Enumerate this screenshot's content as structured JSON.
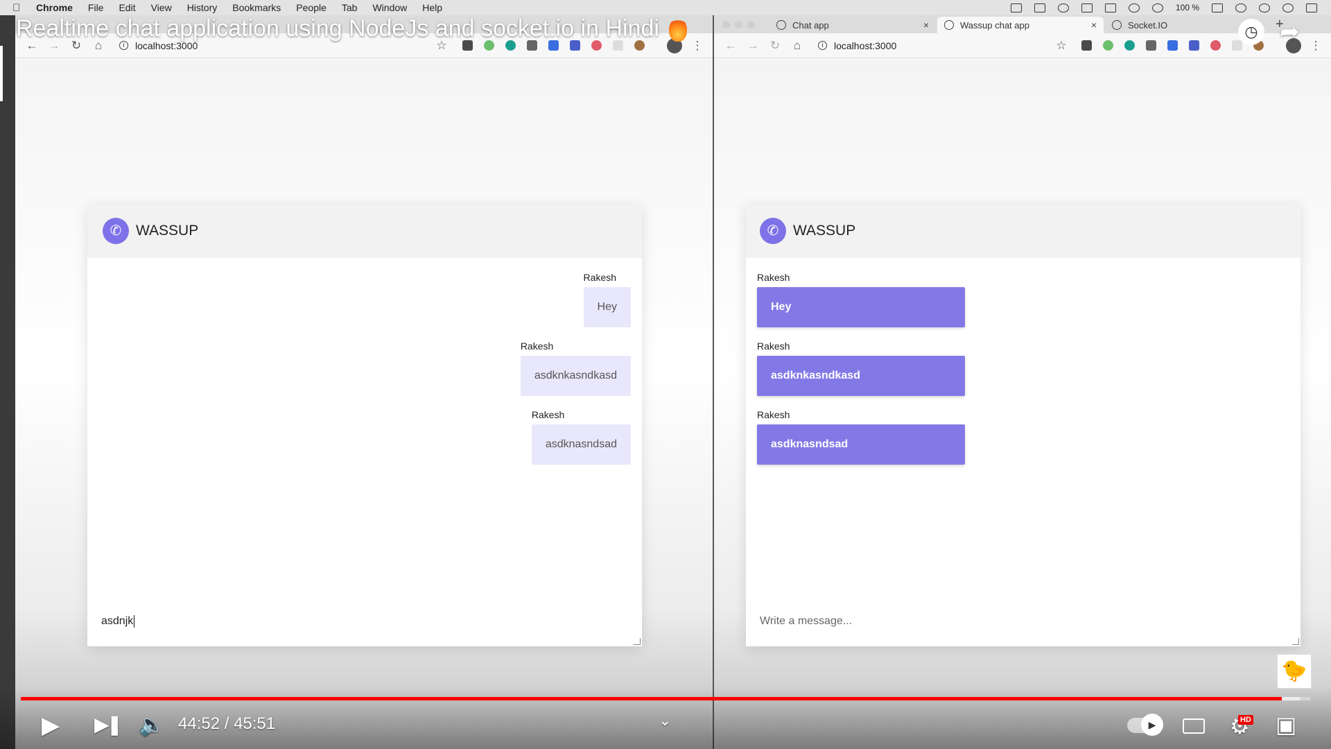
{
  "menubar": {
    "app": "Chrome",
    "items": [
      "File",
      "Edit",
      "View",
      "History",
      "Bookmarks",
      "People",
      "Tab",
      "Window",
      "Help"
    ],
    "battery": "100 %"
  },
  "video": {
    "title": "Realtime chat application using NodeJs and socket.io in Hindi",
    "time_current": "44:52",
    "time_total": "45:51",
    "time_display": "44:52 / 45:51",
    "progress_fraction": 0.978,
    "buffer_fraction": 0.992,
    "hd_badge": "HD"
  },
  "left_browser": {
    "url": "localhost:3000",
    "app_title": "WASSUP",
    "messages": [
      {
        "sender": "Rakesh",
        "text": "Hey"
      },
      {
        "sender": "Rakesh",
        "text": "asdknkasndkasd"
      },
      {
        "sender": "Rakesh",
        "text": "asdknasndsad"
      }
    ],
    "input_value": "asdnjk"
  },
  "right_browser": {
    "tabs": [
      {
        "label": "Chat app",
        "active": false
      },
      {
        "label": "Wassup chat app",
        "active": true
      },
      {
        "label": "Socket.IO",
        "active": false
      }
    ],
    "url": "localhost:3000",
    "app_title": "WASSUP",
    "messages": [
      {
        "sender": "Rakesh",
        "text": "Hey"
      },
      {
        "sender": "Rakesh",
        "text": "asdknkasndkasd"
      },
      {
        "sender": "Rakesh",
        "text": "asdknasndsad"
      }
    ],
    "input_placeholder": "Write a message..."
  },
  "colors": {
    "accent": "#7e72e8",
    "incoming_bubble": "#8379e6",
    "outgoing_bubble": "#e9e7fb",
    "progress": "#ff0000"
  },
  "icons": {
    "nav": [
      "back-arrow-icon",
      "forward-arrow-icon",
      "reload-icon",
      "home-icon"
    ],
    "app": "phone-icon",
    "player": [
      "play-icon",
      "next-icon",
      "volume-icon",
      "autoplay-toggle-icon",
      "captions-icon",
      "settings-icon",
      "exit-fullscreen-icon"
    ]
  }
}
